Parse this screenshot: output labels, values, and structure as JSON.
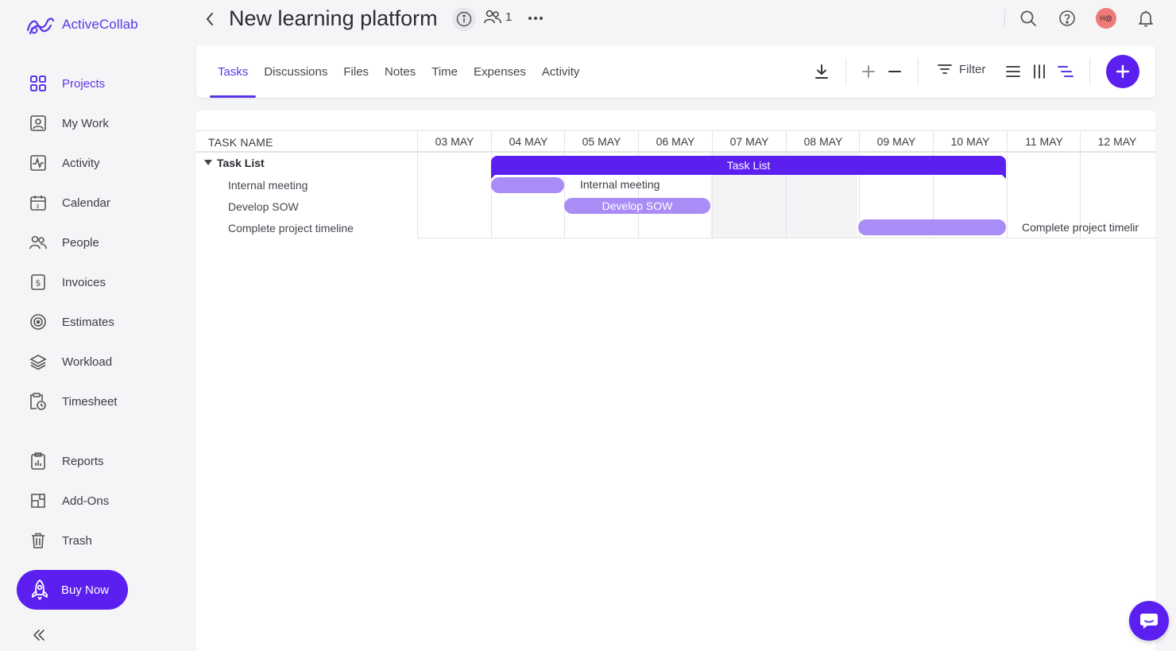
{
  "app": {
    "name": "ActiveCollab"
  },
  "sidebar": {
    "items": [
      {
        "label": "Projects",
        "icon": "grid-icon",
        "active": true
      },
      {
        "label": "My Work",
        "icon": "user-card-icon"
      },
      {
        "label": "Activity",
        "icon": "activity-icon"
      },
      {
        "label": "Calendar",
        "icon": "calendar-icon"
      },
      {
        "label": "People",
        "icon": "people-icon"
      },
      {
        "label": "Invoices",
        "icon": "dollar-doc-icon"
      },
      {
        "label": "Estimates",
        "icon": "target-icon"
      },
      {
        "label": "Workload",
        "icon": "layers-icon"
      },
      {
        "label": "Timesheet",
        "icon": "clipboard-clock-icon"
      },
      {
        "label": "Reports",
        "icon": "report-icon"
      },
      {
        "label": "Add-Ons",
        "icon": "addon-icon"
      },
      {
        "label": "Trash",
        "icon": "trash-icon"
      }
    ],
    "buy_label": "Buy Now"
  },
  "header": {
    "title": "New learning platform",
    "people_count": "1",
    "avatar_initials": "H@"
  },
  "tabs": [
    {
      "label": "Tasks",
      "active": true
    },
    {
      "label": "Discussions"
    },
    {
      "label": "Files"
    },
    {
      "label": "Notes"
    },
    {
      "label": "Time"
    },
    {
      "label": "Expenses"
    },
    {
      "label": "Activity"
    }
  ],
  "toolbar": {
    "filter_label": "Filter"
  },
  "gantt": {
    "task_column_header": "TASK NAME",
    "days": [
      "03 MAY",
      "04 MAY",
      "05 MAY",
      "06 MAY",
      "07 MAY",
      "08 MAY",
      "09 MAY",
      "10 MAY",
      "11 MAY",
      "12 MAY"
    ],
    "group": {
      "name": "Task List",
      "start": "04 MAY",
      "end": "10 MAY"
    },
    "tasks": [
      {
        "name": "Internal meeting",
        "start": "04 MAY",
        "end": "04 MAY",
        "bar_text": "",
        "side_label": "Internal meeting"
      },
      {
        "name": "Develop SOW",
        "start": "05 MAY",
        "end": "06 MAY",
        "bar_text": "Develop SOW",
        "side_label": ""
      },
      {
        "name": "Complete project timeline",
        "start": "09 MAY",
        "end": "10 MAY",
        "bar_text": "",
        "side_label": "Complete project timelir"
      }
    ]
  },
  "colors": {
    "accent": "#5b1ff0",
    "bar_light": "#a98cf5",
    "brand_text": "#5b36e6"
  }
}
